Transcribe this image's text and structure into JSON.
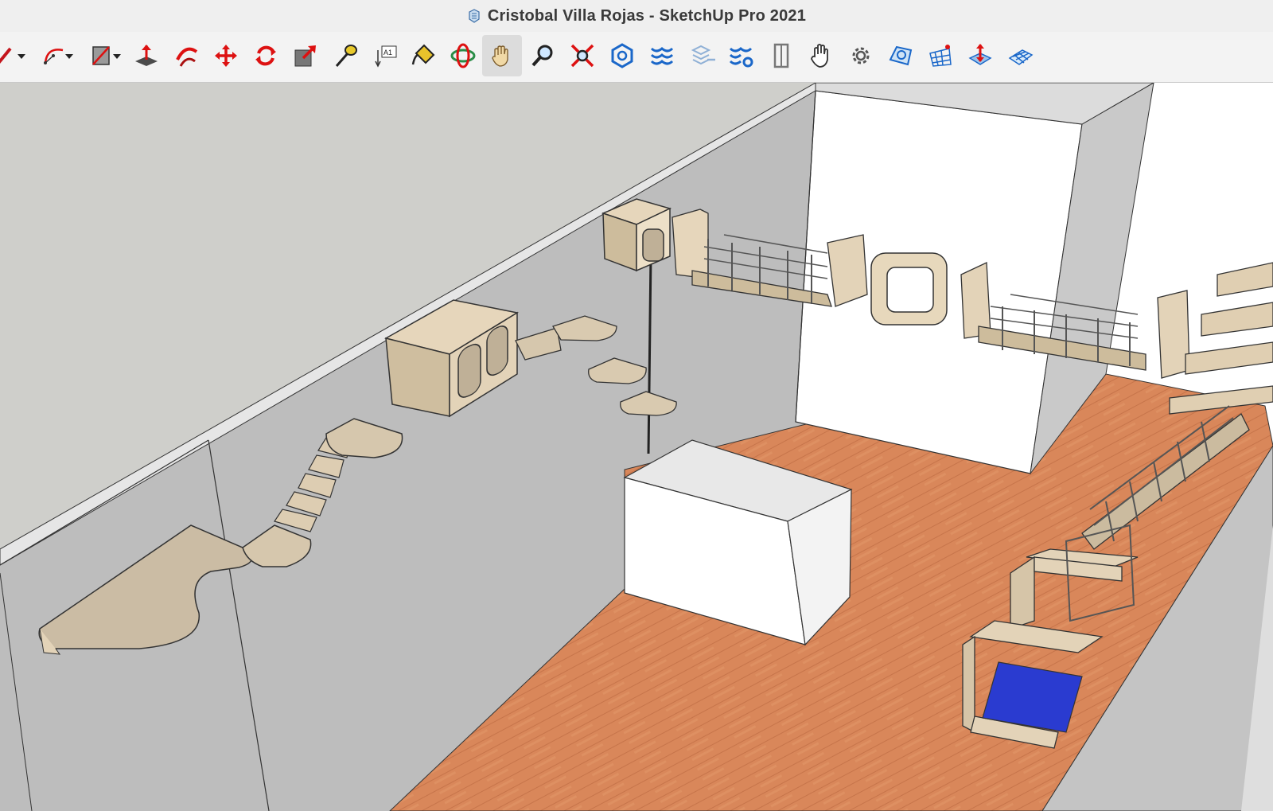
{
  "window": {
    "title": "Cristobal Villa Rojas - SketchUp Pro 2021"
  },
  "toolbar": {
    "tools": [
      {
        "name": "Pencil / Line",
        "icon": "pencil-icon"
      },
      {
        "name": "Arc",
        "icon": "arc-icon"
      },
      {
        "name": "Rectangle",
        "icon": "rectangle-icon"
      },
      {
        "name": "Push/Pull",
        "icon": "push-pull-icon"
      },
      {
        "name": "Follow Me",
        "icon": "follow-me-icon"
      },
      {
        "name": "Move",
        "icon": "move-icon"
      },
      {
        "name": "Rotate",
        "icon": "rotate-icon"
      },
      {
        "name": "Scale",
        "icon": "scale-icon"
      },
      {
        "name": "Tape Measure",
        "icon": "tape-measure-icon"
      },
      {
        "name": "Text",
        "icon": "text-icon",
        "label": "A1"
      },
      {
        "name": "Paint Bucket",
        "icon": "paint-bucket-icon"
      },
      {
        "name": "Orbit",
        "icon": "orbit-icon"
      },
      {
        "name": "Pan",
        "icon": "pan-icon",
        "active": true
      },
      {
        "name": "Zoom",
        "icon": "zoom-icon"
      },
      {
        "name": "Zoom Extents",
        "icon": "zoom-extents-icon"
      },
      {
        "name": "3D Warehouse",
        "icon": "warehouse-icon"
      },
      {
        "name": "Extension Warehouse",
        "icon": "extension-warehouse-icon"
      },
      {
        "name": "Share Component",
        "icon": "share-component-icon"
      },
      {
        "name": "Extension Manager",
        "icon": "extension-manager-icon"
      },
      {
        "name": "Door",
        "icon": "door-icon"
      },
      {
        "name": "Hand",
        "icon": "hand-icon"
      },
      {
        "name": "Settings",
        "icon": "gear-icon"
      },
      {
        "name": "Sandbox From Contours",
        "icon": "sandbox-contours-icon"
      },
      {
        "name": "Sandbox Smoove",
        "icon": "sandbox-smoove-icon"
      },
      {
        "name": "Sandbox Stamp",
        "icon": "sandbox-stamp-icon"
      },
      {
        "name": "Sandbox Drape",
        "icon": "sandbox-drape-icon"
      }
    ]
  },
  "colors": {
    "titlebar_bg": "#efefef",
    "toolbar_bg": "#f3f3f3",
    "wall_left": "#b9b9b9",
    "wall_top": "#d2d2d2",
    "floor": "#d9885a",
    "plywood": "#e3d3b8",
    "blue_cushion": "#2a3bd0"
  }
}
